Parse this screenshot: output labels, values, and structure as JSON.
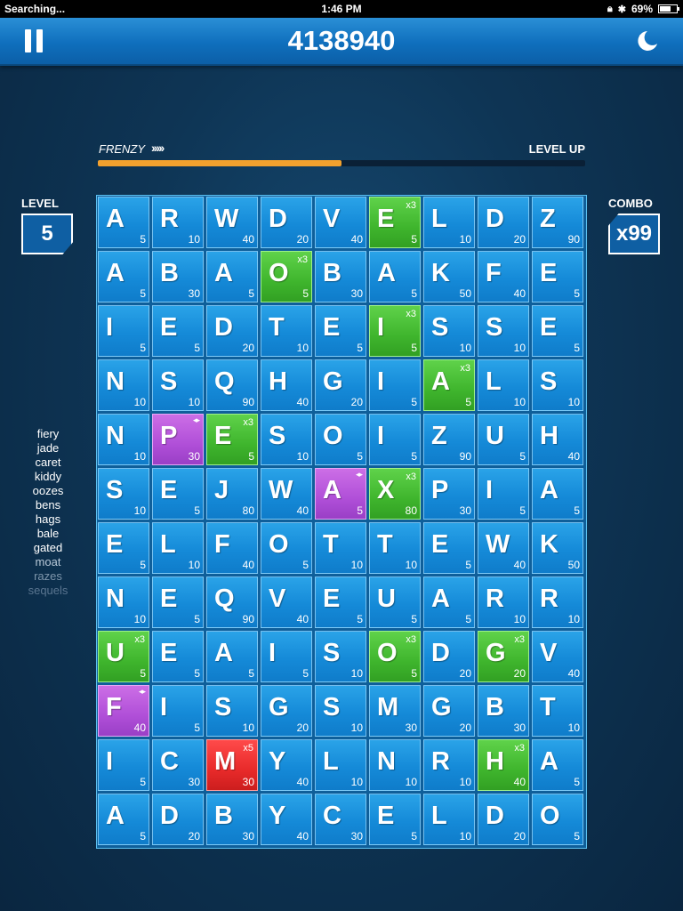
{
  "status_bar": {
    "carrier": "Searching...",
    "time": "1:46 PM",
    "battery": "69%",
    "battery_level": 0.69
  },
  "header": {
    "score": "4138940"
  },
  "progress": {
    "frenzy_label": "FRENZY",
    "frenzy_arrows": "›››››",
    "level_up_label": "LEVEL UP",
    "fill_fraction": 0.5
  },
  "level": {
    "title": "LEVEL",
    "value": "5"
  },
  "combo": {
    "title": "COMBO",
    "value": "x99"
  },
  "words": [
    {
      "text": "fiery",
      "color": "#ffffff"
    },
    {
      "text": "jade",
      "color": "#ffffff"
    },
    {
      "text": "caret",
      "color": "#ffffff"
    },
    {
      "text": "kiddy",
      "color": "#ffffff"
    },
    {
      "text": "oozes",
      "color": "#ffffff"
    },
    {
      "text": "bens",
      "color": "#ffffff"
    },
    {
      "text": "hags",
      "color": "#ffffff"
    },
    {
      "text": "bale",
      "color": "#ffffff"
    },
    {
      "text": "gated",
      "color": "#ffffff"
    },
    {
      "text": "moat",
      "color": "#b8c8d8"
    },
    {
      "text": "razes",
      "color": "#7d95ab"
    },
    {
      "text": "sequels",
      "color": "#5a7590"
    }
  ],
  "colors": {
    "normal": "#158ad8",
    "green": "#3fb52d",
    "purple": "#b04fd8",
    "red": "#e82a2a",
    "progress": "#f2a12e"
  },
  "board": [
    [
      {
        "l": "A",
        "p": "5"
      },
      {
        "l": "R",
        "p": "10"
      },
      {
        "l": "W",
        "p": "40"
      },
      {
        "l": "D",
        "p": "20"
      },
      {
        "l": "V",
        "p": "40"
      },
      {
        "l": "E",
        "p": "5",
        "t": "green",
        "m": "x3"
      },
      {
        "l": "L",
        "p": "10"
      },
      {
        "l": "D",
        "p": "20"
      },
      {
        "l": "Z",
        "p": "90"
      }
    ],
    [
      {
        "l": "A",
        "p": "5"
      },
      {
        "l": "B",
        "p": "30"
      },
      {
        "l": "A",
        "p": "5"
      },
      {
        "l": "O",
        "p": "5",
        "t": "green",
        "m": "x3"
      },
      {
        "l": "B",
        "p": "30"
      },
      {
        "l": "A",
        "p": "5"
      },
      {
        "l": "K",
        "p": "50"
      },
      {
        "l": "F",
        "p": "40"
      },
      {
        "l": "E",
        "p": "5"
      }
    ],
    [
      {
        "l": "I",
        "p": "5"
      },
      {
        "l": "E",
        "p": "5"
      },
      {
        "l": "D",
        "p": "20"
      },
      {
        "l": "T",
        "p": "10"
      },
      {
        "l": "E",
        "p": "5"
      },
      {
        "l": "I",
        "p": "5",
        "t": "green",
        "m": "x3"
      },
      {
        "l": "S",
        "p": "10"
      },
      {
        "l": "S",
        "p": "10"
      },
      {
        "l": "E",
        "p": "5"
      }
    ],
    [
      {
        "l": "N",
        "p": "10"
      },
      {
        "l": "S",
        "p": "10"
      },
      {
        "l": "Q",
        "p": "90"
      },
      {
        "l": "H",
        "p": "40"
      },
      {
        "l": "G",
        "p": "20"
      },
      {
        "l": "I",
        "p": "5"
      },
      {
        "l": "A",
        "p": "5",
        "t": "green",
        "m": "x3"
      },
      {
        "l": "L",
        "p": "10"
      },
      {
        "l": "S",
        "p": "10"
      }
    ],
    [
      {
        "l": "N",
        "p": "10"
      },
      {
        "l": "P",
        "p": "30",
        "t": "purple",
        "s": true
      },
      {
        "l": "E",
        "p": "5",
        "t": "green",
        "m": "x3"
      },
      {
        "l": "S",
        "p": "10"
      },
      {
        "l": "O",
        "p": "5"
      },
      {
        "l": "I",
        "p": "5"
      },
      {
        "l": "Z",
        "p": "90"
      },
      {
        "l": "U",
        "p": "5"
      },
      {
        "l": "H",
        "p": "40"
      }
    ],
    [
      {
        "l": "S",
        "p": "10"
      },
      {
        "l": "E",
        "p": "5"
      },
      {
        "l": "J",
        "p": "80"
      },
      {
        "l": "W",
        "p": "40"
      },
      {
        "l": "A",
        "p": "5",
        "t": "purple",
        "s": true
      },
      {
        "l": "X",
        "p": "80",
        "t": "green",
        "m": "x3"
      },
      {
        "l": "P",
        "p": "30"
      },
      {
        "l": "I",
        "p": "5"
      },
      {
        "l": "A",
        "p": "5"
      }
    ],
    [
      {
        "l": "E",
        "p": "5"
      },
      {
        "l": "L",
        "p": "10"
      },
      {
        "l": "F",
        "p": "40"
      },
      {
        "l": "O",
        "p": "5"
      },
      {
        "l": "T",
        "p": "10"
      },
      {
        "l": "T",
        "p": "10"
      },
      {
        "l": "E",
        "p": "5"
      },
      {
        "l": "W",
        "p": "40"
      },
      {
        "l": "K",
        "p": "50"
      }
    ],
    [
      {
        "l": "N",
        "p": "10"
      },
      {
        "l": "E",
        "p": "5"
      },
      {
        "l": "Q",
        "p": "90"
      },
      {
        "l": "V",
        "p": "40"
      },
      {
        "l": "E",
        "p": "5"
      },
      {
        "l": "U",
        "p": "5"
      },
      {
        "l": "A",
        "p": "5"
      },
      {
        "l": "R",
        "p": "10"
      },
      {
        "l": "R",
        "p": "10"
      }
    ],
    [
      {
        "l": "U",
        "p": "5",
        "t": "green",
        "m": "x3"
      },
      {
        "l": "E",
        "p": "5"
      },
      {
        "l": "A",
        "p": "5"
      },
      {
        "l": "I",
        "p": "5"
      },
      {
        "l": "S",
        "p": "10"
      },
      {
        "l": "O",
        "p": "5",
        "t": "green",
        "m": "x3"
      },
      {
        "l": "D",
        "p": "20"
      },
      {
        "l": "G",
        "p": "20",
        "t": "green",
        "m": "x3"
      },
      {
        "l": "V",
        "p": "40"
      }
    ],
    [
      {
        "l": "F",
        "p": "40",
        "t": "purple",
        "s": true
      },
      {
        "l": "I",
        "p": "5"
      },
      {
        "l": "S",
        "p": "10"
      },
      {
        "l": "G",
        "p": "20"
      },
      {
        "l": "S",
        "p": "10"
      },
      {
        "l": "M",
        "p": "30"
      },
      {
        "l": "G",
        "p": "20"
      },
      {
        "l": "B",
        "p": "30"
      },
      {
        "l": "T",
        "p": "10"
      }
    ],
    [
      {
        "l": "I",
        "p": "5"
      },
      {
        "l": "C",
        "p": "30"
      },
      {
        "l": "M",
        "p": "30",
        "t": "red",
        "m": "x5"
      },
      {
        "l": "Y",
        "p": "40"
      },
      {
        "l": "L",
        "p": "10"
      },
      {
        "l": "N",
        "p": "10"
      },
      {
        "l": "R",
        "p": "10"
      },
      {
        "l": "H",
        "p": "40",
        "t": "green",
        "m": "x3"
      },
      {
        "l": "A",
        "p": "5"
      }
    ],
    [
      {
        "l": "A",
        "p": "5"
      },
      {
        "l": "D",
        "p": "20"
      },
      {
        "l": "B",
        "p": "30"
      },
      {
        "l": "Y",
        "p": "40"
      },
      {
        "l": "C",
        "p": "30"
      },
      {
        "l": "E",
        "p": "5"
      },
      {
        "l": "L",
        "p": "10"
      },
      {
        "l": "D",
        "p": "20"
      },
      {
        "l": "O",
        "p": "5"
      }
    ]
  ]
}
